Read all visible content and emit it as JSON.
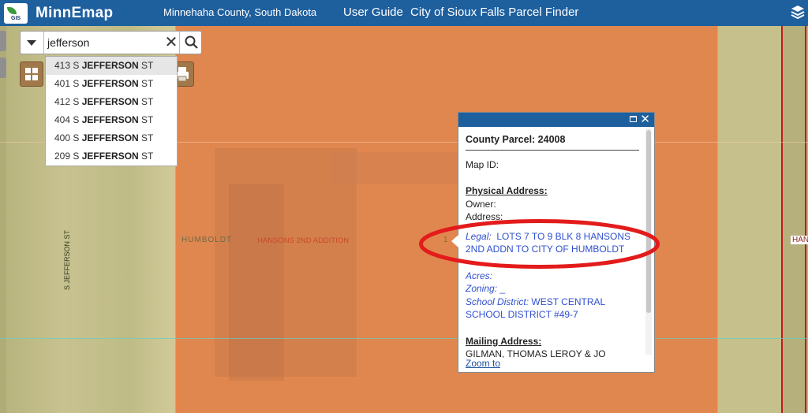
{
  "header": {
    "logo_text": "GIS",
    "title": "MinnEmap",
    "county": "Minnehaha County, South Dakota",
    "user_guide": "User Guide",
    "parcel_finder": "City of Sioux Falls Parcel Finder",
    "color": "#1e5f9e"
  },
  "search": {
    "value": "jefferson",
    "suggestions": [
      {
        "prefix": "413 S ",
        "match": "JEFFERSON",
        "suffix": " ST"
      },
      {
        "prefix": "401 S ",
        "match": "JEFFERSON",
        "suffix": " ST"
      },
      {
        "prefix": "412 S ",
        "match": "JEFFERSON",
        "suffix": " ST"
      },
      {
        "prefix": "404 S ",
        "match": "JEFFERSON",
        "suffix": " ST"
      },
      {
        "prefix": "400 S ",
        "match": "JEFFERSON",
        "suffix": " ST"
      },
      {
        "prefix": "209 S ",
        "match": "JEFFERSON",
        "suffix": " ST"
      }
    ]
  },
  "map": {
    "labels": {
      "humboldt": "HUMBOLDT",
      "hansons": "HANSONS 2ND  ADDITION",
      "street": "S JEFFERSON ST",
      "han": "HAN",
      "one": "1"
    },
    "parcel_color": "#e0874f"
  },
  "popup": {
    "title": "County Parcel: 24008",
    "map_id": "Map ID:",
    "physical_address": "Physical Address:",
    "owner": "Owner:",
    "address": "Address:",
    "legal_label": "Legal:",
    "legal_line1": "  LOTS 7 TO 9 BLK 8 HANSONS",
    "legal_line2": "2ND ADDN TO CITY OF HUMBOLDT",
    "acres": "Acres:",
    "zoning": "Zoning:",
    "zoning_value": " _",
    "school_label": "School District:",
    "school_line1": " WEST CENTRAL",
    "school_line2": "SCHOOL DISTRICT #49-7",
    "mailing": "Mailing Address:",
    "mailing_name": "GILMAN, THOMAS LEROY & JO",
    "zoom": "Zoom to"
  },
  "annotation_color": "#e31b1b"
}
